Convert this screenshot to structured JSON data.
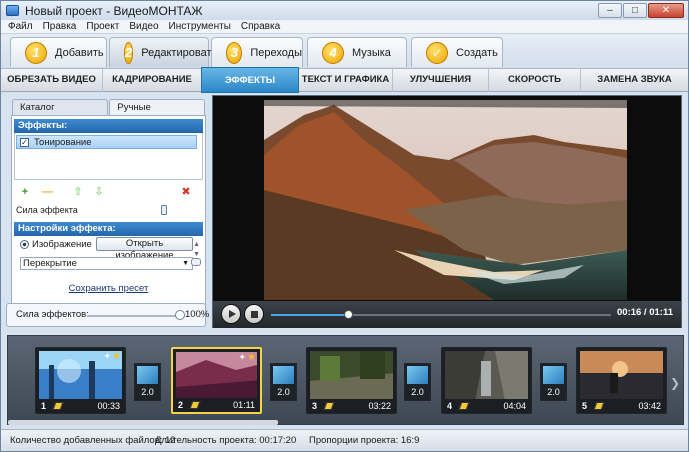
{
  "window": {
    "title": "Новый проект - ВидеоМОНТАЖ"
  },
  "menu": [
    "Файл",
    "Правка",
    "Проект",
    "Видео",
    "Инструменты",
    "Справка"
  ],
  "steps": [
    {
      "num": "1",
      "label": "Добавить"
    },
    {
      "num": "2",
      "label": "Редактировать",
      "active": true
    },
    {
      "num": "3",
      "label": "Переходы"
    },
    {
      "num": "4",
      "label": "Музыка"
    },
    {
      "num": "✓",
      "label": "Создать"
    }
  ],
  "subtabs": [
    "ОБРЕЗАТЬ ВИДЕО",
    "КАДРИРОВАНИЕ",
    "ЭФФЕКТЫ",
    "ТЕКСТ И ГРАФИКА",
    "УЛУЧШЕНИЯ",
    "СКОРОСТЬ",
    "ЗАМЕНА ЗВУКА"
  ],
  "subtabs_active": "ЭФФЕКТЫ",
  "left_panel": {
    "tab_catalog": "Каталог эффектов",
    "tab_manual": "Ручные настройки",
    "effects_header": "Эффекты:",
    "effect_item": "Тонирование",
    "strength_label": "Сила эффекта",
    "strength_value": 1.0,
    "settings_header": "Настройки эффекта:",
    "image_label": "Изображение",
    "open_image_button": "Открыть изображение",
    "blend_mode": "Перекрытие",
    "save_preset": "Сохранить пресет",
    "global_strength_label": "Сила эффектов:",
    "global_strength_value": "100%"
  },
  "player": {
    "timecode": "00:16 / 01:11",
    "progress": 0.225
  },
  "timeline": {
    "clips": [
      {
        "num": "1",
        "duration": "00:33"
      },
      {
        "num": "2",
        "duration": "01:11",
        "selected": true
      },
      {
        "num": "3",
        "duration": "03:22"
      },
      {
        "num": "4",
        "duration": "04:04"
      },
      {
        "num": "5",
        "duration": "03:42"
      }
    ],
    "transition_duration": "2.0"
  },
  "status": {
    "files": "Количество добавленных файлов: 12",
    "duration": "Длительность проекта: 00:17:20",
    "aspect": "Пропорции проекта: 16:9"
  }
}
